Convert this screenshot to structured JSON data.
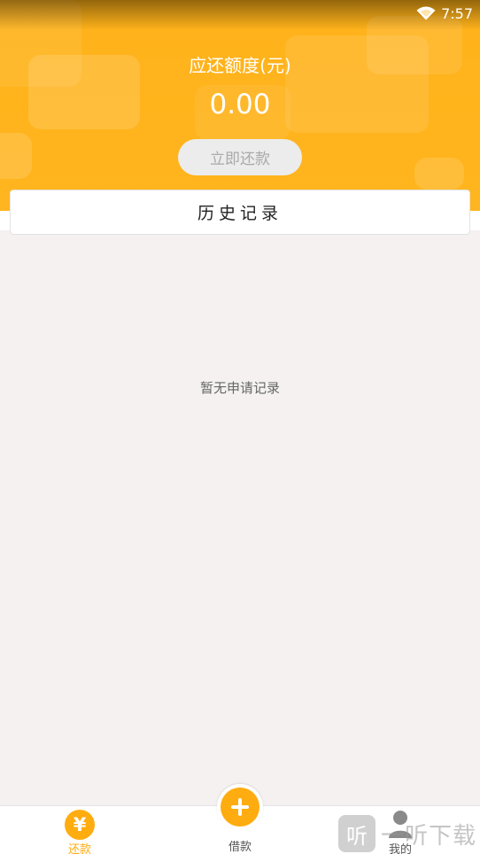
{
  "status_bar": {
    "time": "7:57"
  },
  "header": {
    "amount_label": "应还额度(元)",
    "amount_value": "0.00",
    "repay_button": "立即还款"
  },
  "history": {
    "title": "历史记录",
    "empty_text": "暂无申请记录"
  },
  "bottom_nav": {
    "items": [
      {
        "label": "还款",
        "icon": "yen-icon",
        "active": true
      },
      {
        "label": "借款",
        "icon": "plus-icon",
        "active": false
      },
      {
        "label": "我的",
        "icon": "person-icon",
        "active": false
      }
    ]
  },
  "watermark": {
    "badge": "听",
    "text": "一听下载"
  },
  "colors": {
    "accent": "#ffac10",
    "header": "#ffb21a",
    "background": "#f4f1f0"
  }
}
